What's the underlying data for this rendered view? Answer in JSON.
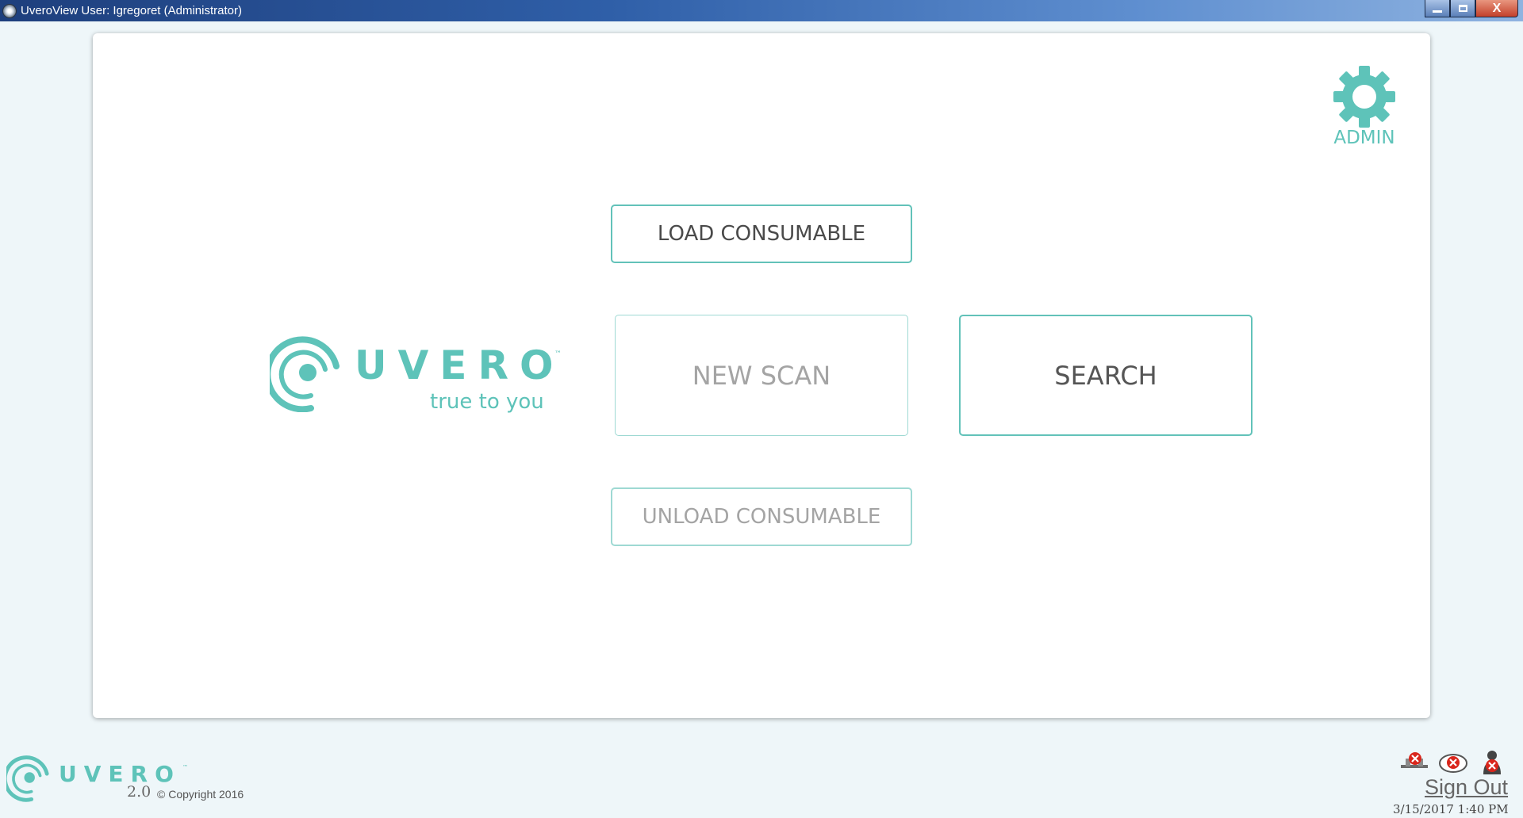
{
  "window": {
    "title": "UveroView User: Igregoret (Administrator)",
    "close_glyph": "X"
  },
  "admin": {
    "label": "ADMIN",
    "icon": "gear-icon"
  },
  "buttons": {
    "load_consumable": "LOAD CONSUMABLE",
    "new_scan": "NEW SCAN",
    "search": "SEARCH",
    "unload_consumable": "UNLOAD CONSUMABLE"
  },
  "brand": {
    "name": "UVERO",
    "trademark": "™",
    "tagline": "true to you",
    "accent_color": "#5ec3b9"
  },
  "footer": {
    "brand": "UVERO",
    "trademark": "™",
    "version": "2.0",
    "copyright": "© Copyright 2016",
    "sign_out": "Sign Out",
    "datetime": "3/15/2017 1:40 PM",
    "status_icons": [
      "network-disconnected-icon",
      "cloud-disconnected-icon",
      "user-disconnected-icon"
    ]
  }
}
